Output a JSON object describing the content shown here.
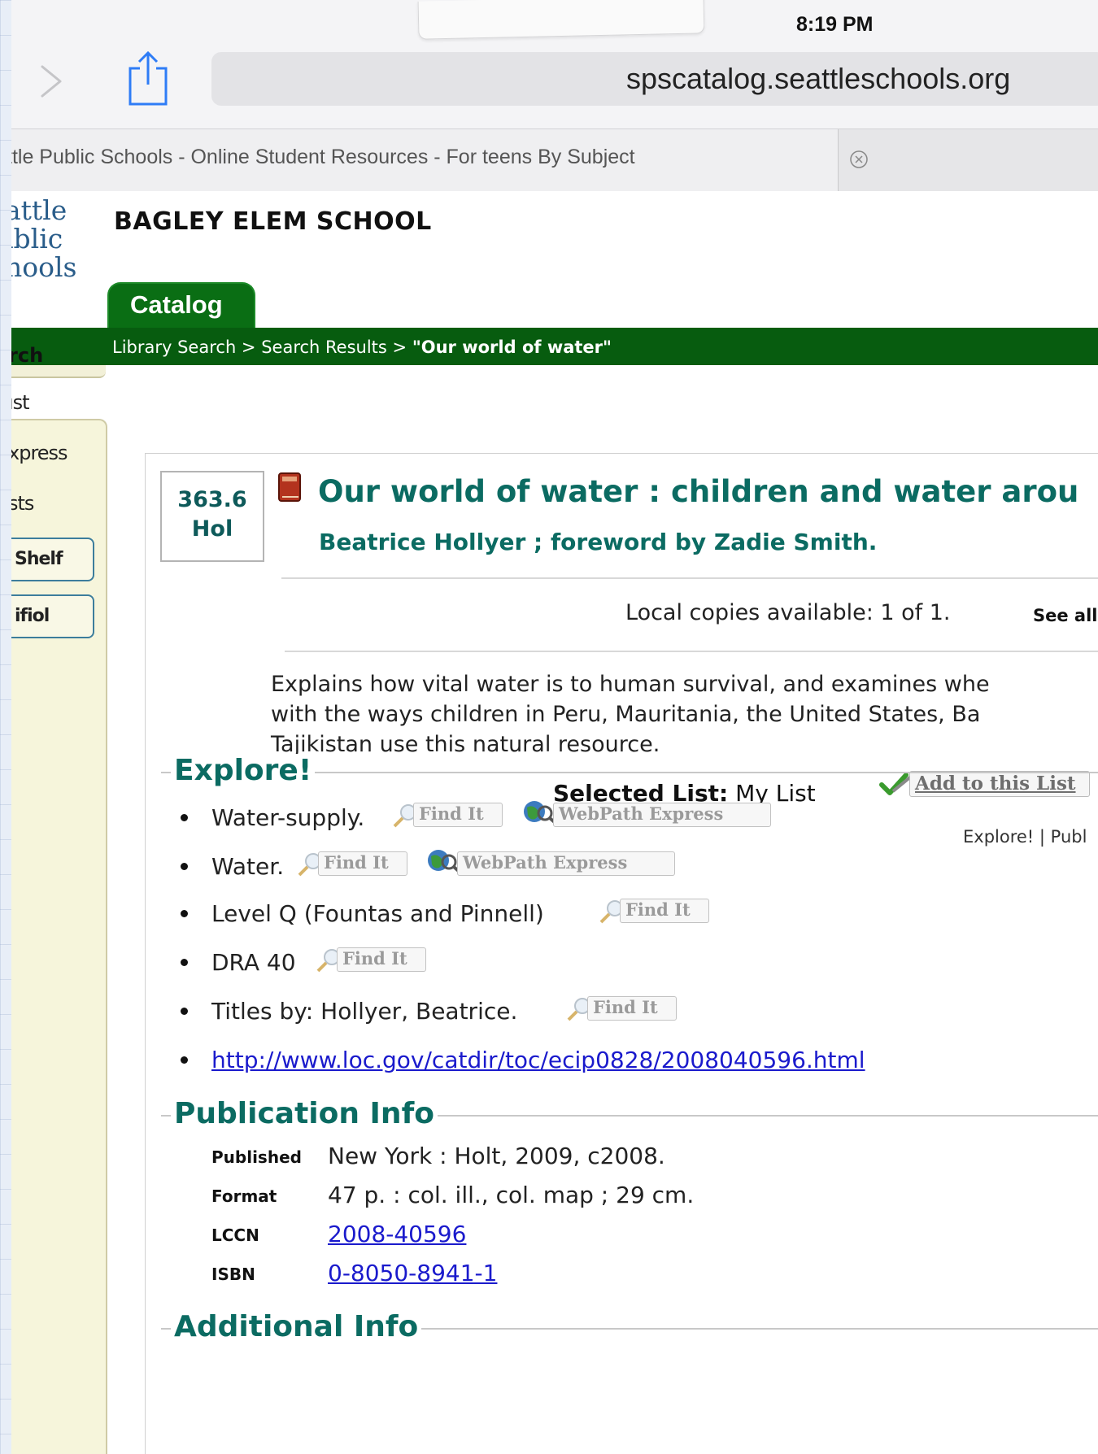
{
  "status_bar": {
    "time": "8:19 PM"
  },
  "browser": {
    "url": "spscatalog.seattleschools.org",
    "tab_title": "ttle Public Schools - Online Student Resources - For teens By Subject"
  },
  "header": {
    "logo_lines": [
      "attle",
      "ıblic",
      "hools"
    ],
    "school_name": "BAGLEY ELEM SCHOOL",
    "catalog_tab": "Catalog",
    "breadcrumb": {
      "library_search": "Library Search",
      "sep1": " > ",
      "search_results": "Search Results",
      "sep2": " > ",
      "current": "\"Our world of water\""
    }
  },
  "sidebar": {
    "search": "rch",
    "items": [
      "ıst",
      "xpress",
      "sts"
    ],
    "buttons": [
      "Shelf",
      "ifiol"
    ]
  },
  "record": {
    "call_number": [
      "363.6",
      "Hol"
    ],
    "title": "Our world of water : children and water arou",
    "author": "Beatrice Hollyer ; foreword by Zadie Smith.",
    "copies": "Local copies available: 1 of 1.",
    "see_all": "See all",
    "summary": [
      "Explains how vital water is to human survival, and examines whe",
      "with the ways children in Peru, Mauritania, the United States, Ba",
      "Tajikistan use this natural resource."
    ],
    "selected_list_label": "Selected List:",
    "selected_list_value": "My List",
    "add_to_list": "Add to this List",
    "explore_links": "Explore! | Publ"
  },
  "explore": {
    "heading": "Explore!",
    "find_it": "Find It",
    "webpath": "WebPath Express",
    "items": [
      "Water-supply.",
      "Water.",
      "Level Q (Fountas and Pinnell)",
      "DRA 40",
      "Titles by: Hollyer, Beatrice.",
      "http://www.loc.gov/catdir/toc/ecip0828/2008040596.html"
    ]
  },
  "publication": {
    "heading": "Publication Info",
    "published_label": "Published",
    "published_value": "New York : Holt, 2009, c2008.",
    "format_label": "Format",
    "format_value": "47 p. : col. ill., col. map ; 29 cm.",
    "lccn_label": "LCCN",
    "lccn_value": "2008-40596",
    "isbn_label": "ISBN",
    "isbn_value": "0-8050-8941-1"
  },
  "additional": {
    "heading": "Additional Info"
  },
  "colors": {
    "brand_green": "#075c0f",
    "title_teal": "#0b6b62",
    "link_blue": "#1a1acc",
    "sidebar_bg": "#f6f5db"
  }
}
